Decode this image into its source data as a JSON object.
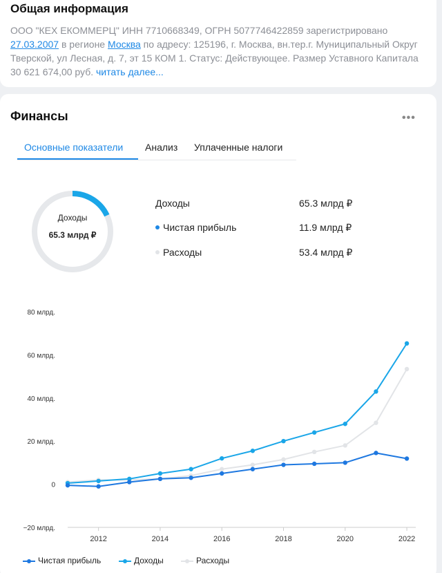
{
  "info": {
    "title": "Общая информация",
    "text_1": "ООО \"КЕХ ЕКОММЕРЦ\" ИНН 7710668349, ОГРН 5077746422859 зарегистрировано ",
    "date_link": "27.03.2007",
    "text_2": " в регионе ",
    "region_link": "Москва",
    "text_3": " по адресу: 125196, г. Москва, вн.тер.г. Муниципальный Округ Тверской, ул Лесная, д. 7, эт 15 КОМ 1. Статус: Действующее. Размер Уставного Капитала 30 621 674,00 руб. ",
    "more_link": "читать далее..."
  },
  "finance": {
    "title": "Финансы",
    "more_icon": "ellipsis-icon",
    "tabs": [
      "Основные показатели",
      "Анализ",
      "Уплаченные налоги"
    ],
    "donut": {
      "label": "Доходы",
      "value": "65.3 млрд ₽",
      "fill_fraction": 0.18
    },
    "metrics": [
      {
        "label": "Доходы",
        "value": "65.3 млрд ₽",
        "color": ""
      },
      {
        "label": "Чистая прибыль",
        "value": "11.9 млрд ₽",
        "color": "#1e88e5"
      },
      {
        "label": "Расходы",
        "value": "53.4 млрд ₽",
        "color": "#e2e4e7"
      }
    ]
  },
  "chart_data": {
    "type": "line",
    "title": "",
    "xlabel": "",
    "ylabel": "",
    "x": [
      2011,
      2012,
      2013,
      2014,
      2015,
      2016,
      2017,
      2018,
      2019,
      2020,
      2021,
      2022
    ],
    "xticks": [
      2012,
      2014,
      2016,
      2018,
      2020,
      2022
    ],
    "yticks": [
      {
        "value": 80,
        "label": "80 млрд."
      },
      {
        "value": 60,
        "label": "60 млрд."
      },
      {
        "value": 40,
        "label": "40 млрд."
      },
      {
        "value": 20,
        "label": "20 млрд."
      },
      {
        "value": 0,
        "label": "0"
      },
      {
        "value": -20,
        "label": "−20 млрд."
      }
    ],
    "xlim": [
      2011,
      2022.2
    ],
    "ylim": [
      -20,
      80
    ],
    "grid": false,
    "legend_position": "bottom-left",
    "series": [
      {
        "name": "Расходы",
        "color": "#e2e4e7",
        "values": [
          1.0,
          2.0,
          2.0,
          2.5,
          4.0,
          7.0,
          9.0,
          11.5,
          15.0,
          18.0,
          28.5,
          53.4
        ]
      },
      {
        "name": "Доходы",
        "color": "#1aa6e8",
        "values": [
          0.5,
          1.5,
          2.5,
          5.0,
          7.0,
          12.0,
          15.5,
          20.0,
          24.0,
          28.0,
          43.0,
          65.3
        ]
      },
      {
        "name": "Чистая прибыль",
        "color": "#1e78e0",
        "values": [
          -0.5,
          -1.0,
          1.0,
          2.5,
          3.0,
          5.0,
          7.0,
          9.0,
          9.5,
          10.0,
          14.5,
          11.9
        ]
      }
    ],
    "legend": [
      {
        "name": "Чистая прибыль",
        "color": "#1e78e0"
      },
      {
        "name": "Доходы",
        "color": "#1aa6e8"
      },
      {
        "name": "Расходы",
        "color": "#e2e4e7"
      }
    ]
  }
}
